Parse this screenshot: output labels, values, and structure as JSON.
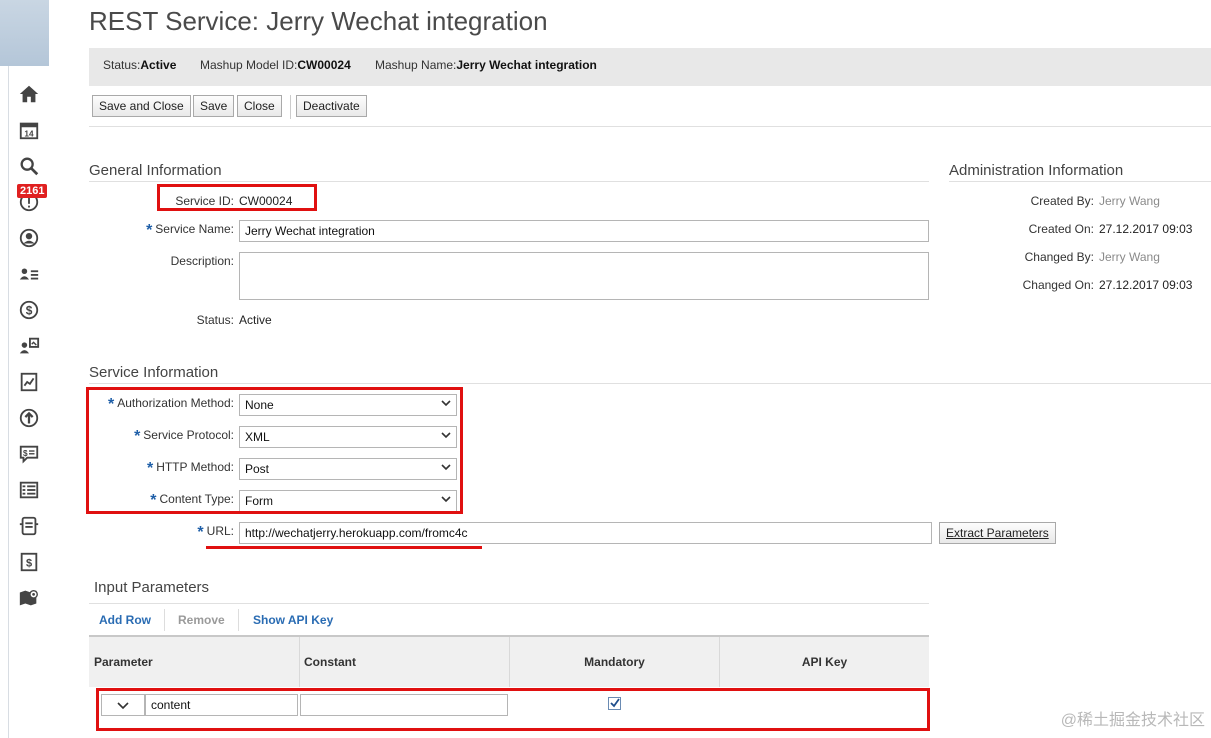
{
  "page": {
    "title": "REST Service: Jerry Wechat integration"
  },
  "status_bar": {
    "status_label": "Status:",
    "status_value": "Active",
    "model_label": "Mashup Model ID:",
    "model_value": "CW00024",
    "name_label": "Mashup Name:",
    "name_value": "Jerry Wechat integration"
  },
  "toolbar": {
    "save_close": "Save and Close",
    "save": "Save",
    "close": "Close",
    "deactivate": "Deactivate"
  },
  "sidebar": {
    "badge": "2161",
    "icons": [
      "home-icon",
      "calendar-icon",
      "search-icon",
      "alert-icon",
      "person-icon",
      "team-list-icon",
      "currency-icon",
      "sales-icon",
      "report-icon",
      "growth-icon",
      "quote-icon",
      "list-icon",
      "device-icon",
      "invoice-icon",
      "map-icon"
    ]
  },
  "general": {
    "title": "General Information",
    "service_id_label": "Service ID:",
    "service_id_value": "CW00024",
    "service_name_label": "Service Name:",
    "service_name_value": "Jerry Wechat integration",
    "description_label": "Description:",
    "description_value": "",
    "status_label": "Status:",
    "status_value": "Active"
  },
  "admin": {
    "title": "Administration Information",
    "created_by_label": "Created By:",
    "created_by_value": "Jerry Wang",
    "created_on_label": "Created On:",
    "created_on_value": "27.12.2017 09:03",
    "changed_by_label": "Changed By:",
    "changed_by_value": "Jerry Wang",
    "changed_on_label": "Changed On:",
    "changed_on_value": "27.12.2017 09:03"
  },
  "service": {
    "title": "Service Information",
    "auth_label": "Authorization Method:",
    "auth_value": "None",
    "protocol_label": "Service Protocol:",
    "protocol_value": "XML",
    "http_label": "HTTP Method:",
    "http_value": "Post",
    "content_label": "Content Type:",
    "content_value": "Form",
    "url_label": "URL:",
    "url_value": "http://wechatjerry.herokuapp.com/fromc4c",
    "extract_button": "Extract Parameters"
  },
  "input_params": {
    "title": "Input Parameters",
    "add_row": "Add Row",
    "remove": "Remove",
    "show_api_key": "Show API Key",
    "columns": [
      "Parameter",
      "Constant",
      "Mandatory",
      "API Key"
    ],
    "rows": [
      {
        "parameter": "content",
        "constant": "",
        "mandatory": true
      }
    ]
  },
  "watermark": "@稀土掘金技术社区",
  "colors": {
    "accent": "#2a6cb3",
    "highlight": "#e01010",
    "required": "#1f5fa8"
  }
}
